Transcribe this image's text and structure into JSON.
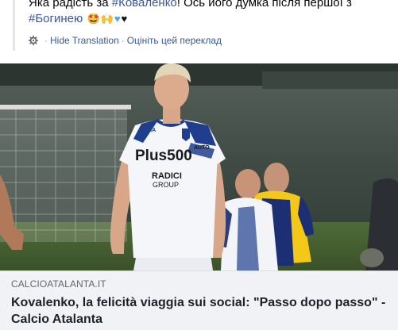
{
  "post": {
    "text_line1_prefix": "Яка радість за ",
    "hashtag_kovalenko": "#Коваленко",
    "text_line1_suffix": "! Ось його думка після першої з",
    "hashtag_goddess": "#Богинею",
    "emoji_names": [
      "star-struck-emoji",
      "clapping-hands-emoji",
      "blue-heart-emoji",
      "black-heart-emoji"
    ]
  },
  "translation": {
    "hide_label": "Hide Translation",
    "rate_label": "Оцініть цей переклад",
    "separator": "·"
  },
  "link_preview": {
    "domain": "CALCIOATALANTA.IT",
    "title": "Kovalenko, la felicità viaggia sui social: \"Passo dopo passo\" - Calcio Atalanta"
  },
  "colors": {
    "link": "#385898",
    "preview_bg": "#f0f2f5",
    "kit_blue": "#1f3f8e",
    "opponent_yellow": "#f3c817"
  }
}
